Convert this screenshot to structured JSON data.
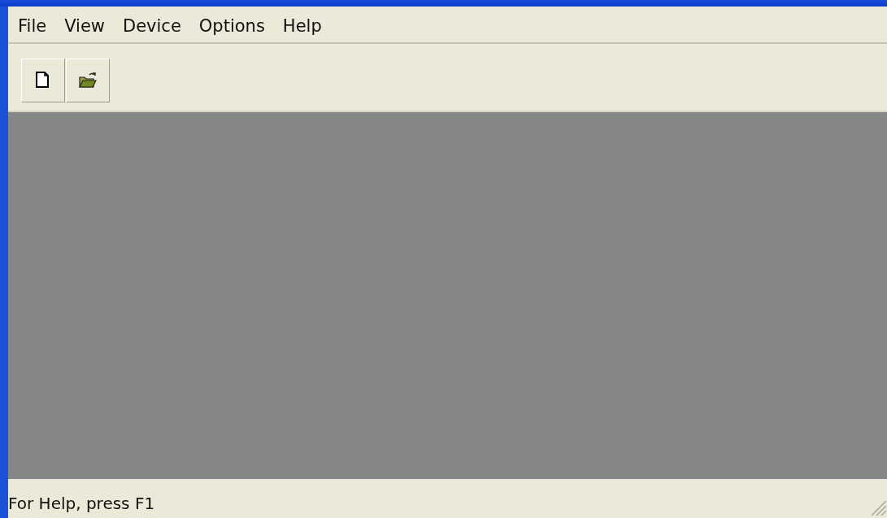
{
  "menu": [
    {
      "label": "File"
    },
    {
      "label": "View"
    },
    {
      "label": "Device"
    },
    {
      "label": "Options"
    },
    {
      "label": "Help"
    }
  ],
  "toolbar": [
    {
      "kind": "new"
    },
    {
      "kind": "open"
    }
  ],
  "status_bar": {
    "text": "For Help, press F1"
  }
}
